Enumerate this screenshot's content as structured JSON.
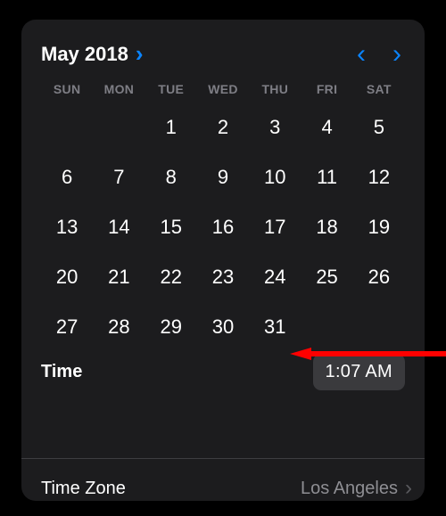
{
  "header": {
    "month_label": "May 2018"
  },
  "weekdays": [
    "SUN",
    "MON",
    "TUE",
    "WED",
    "THU",
    "FRI",
    "SAT"
  ],
  "days_leading_blanks": 2,
  "days": [
    "1",
    "2",
    "3",
    "4",
    "5",
    "6",
    "7",
    "8",
    "9",
    "10",
    "11",
    "12",
    "13",
    "14",
    "15",
    "16",
    "17",
    "18",
    "19",
    "20",
    "21",
    "22",
    "23",
    "24",
    "25",
    "26",
    "27",
    "28",
    "29",
    "30",
    "31"
  ],
  "time": {
    "label": "Time",
    "value": "1:07 AM"
  },
  "timezone": {
    "label": "Time Zone",
    "value": "Los Angeles"
  },
  "colors": {
    "accent": "#0a84ff",
    "card": "#1c1c1e",
    "muted": "#8e8e93",
    "annotation": "#ff0000"
  }
}
